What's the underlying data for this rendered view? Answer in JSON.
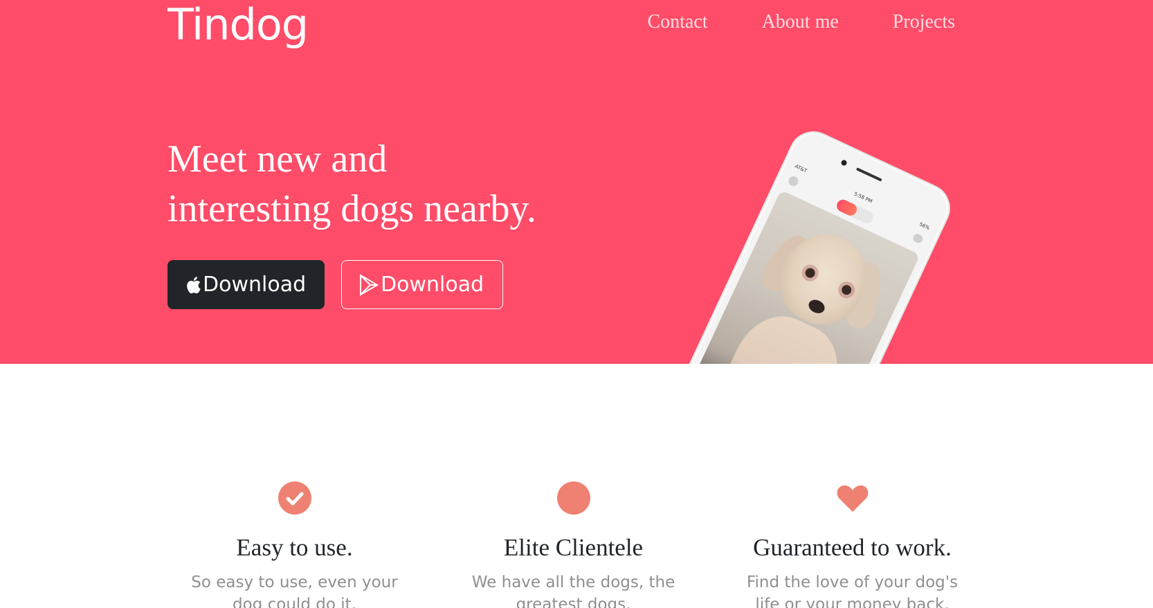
{
  "colors": {
    "brand": "#ff4c68",
    "dark_button": "#212529",
    "feature_icon": "#ef8172",
    "muted_text": "#8f8f8f"
  },
  "nav": {
    "brand": "Tindog",
    "links": [
      "Contact",
      "About me",
      "Projects"
    ]
  },
  "hero": {
    "headline_line1": "Meet new and",
    "headline_line2": "interesting dogs nearby.",
    "apple_button": {
      "icon": "apple-icon",
      "label": "Download"
    },
    "play_button": {
      "icon": "google-play-icon",
      "label": "Download"
    }
  },
  "phone": {
    "carrier": "AT&T",
    "time": "5:58 PM",
    "battery": "56%"
  },
  "features": [
    {
      "icon": "check-circle-icon",
      "title": "Easy to use.",
      "text": "So easy to use, even your dog could do it."
    },
    {
      "icon": "circle-icon",
      "title": "Elite Clientele",
      "text": "We have all the dogs, the greatest dogs."
    },
    {
      "icon": "heart-icon",
      "title": "Guaranteed to work.",
      "text": "Find the love of your dog's life or your money back."
    }
  ]
}
